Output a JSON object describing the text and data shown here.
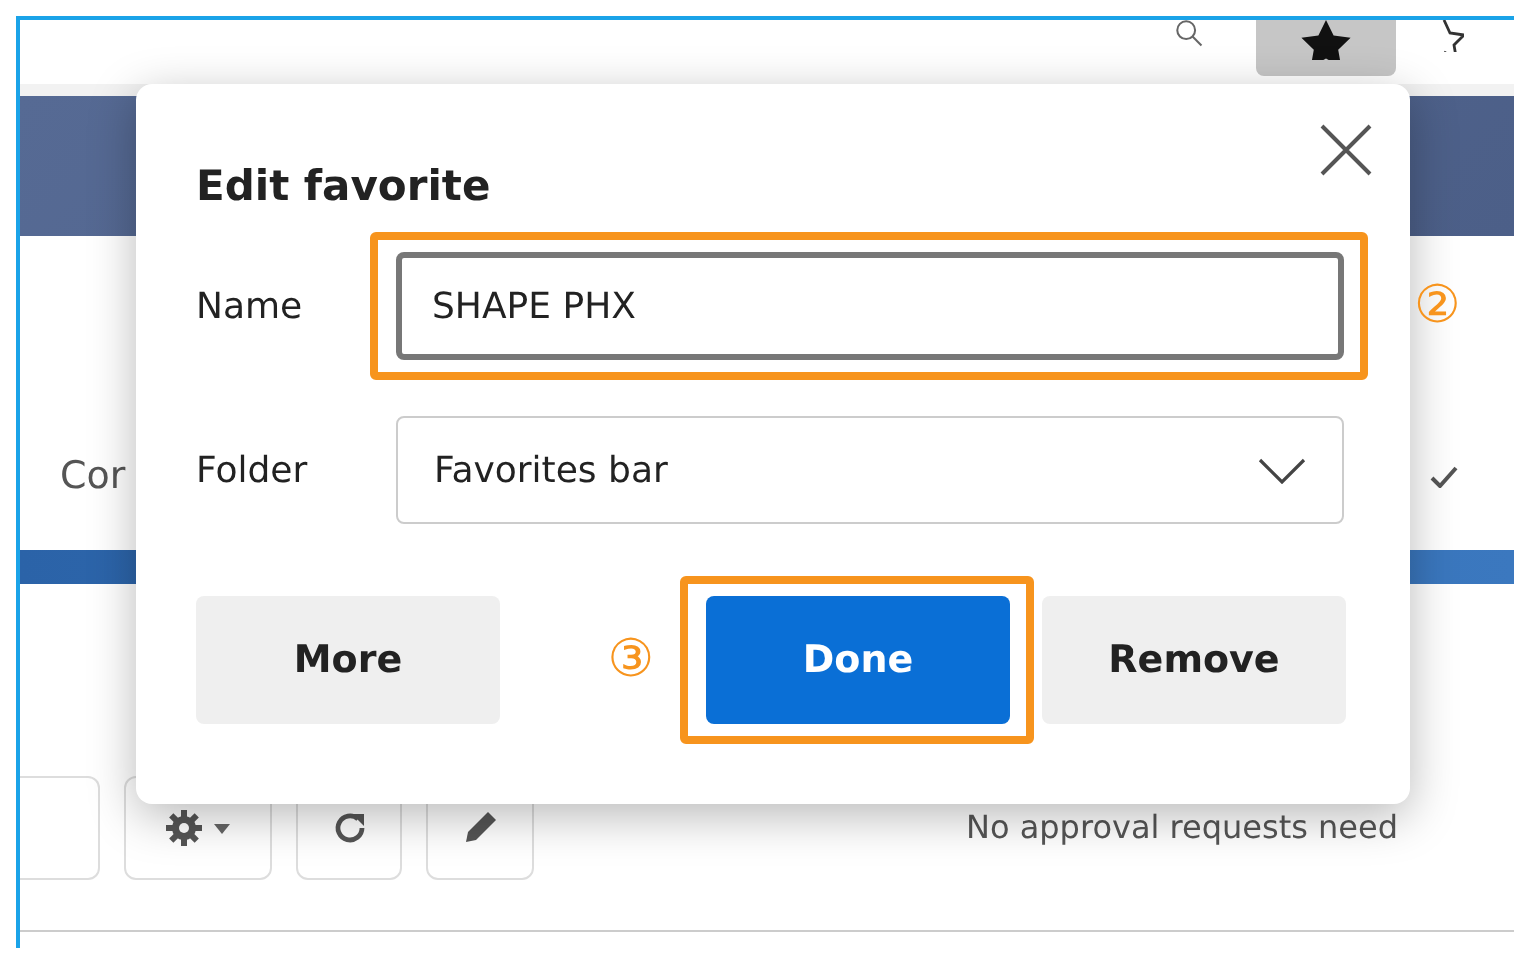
{
  "background_page": {
    "column_label": "Cor",
    "message": "No approval requests need"
  },
  "dialog": {
    "title": "Edit favorite",
    "fields": [
      {
        "label": "Name",
        "kind": "text",
        "value": "SHAPE PHX",
        "focused": true,
        "annotation": "②"
      },
      {
        "label": "Folder",
        "kind": "dropdown",
        "value": "Favorites bar",
        "focused": false
      }
    ],
    "buttons": [
      {
        "label": "More",
        "kind": "secondary"
      },
      {
        "label": "Done",
        "kind": "primary",
        "annotation": "③"
      },
      {
        "label": "Remove",
        "kind": "secondary"
      }
    ]
  }
}
